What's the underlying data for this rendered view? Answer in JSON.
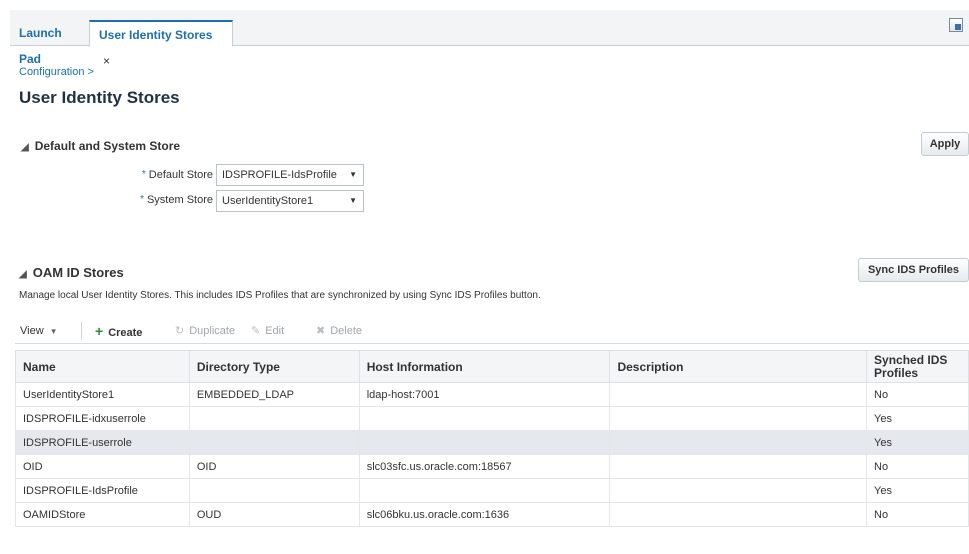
{
  "tabs": [
    {
      "label": "Launch Pad"
    },
    {
      "label": "User Identity Stores",
      "close": "×"
    }
  ],
  "breadcrumb": "Configuration >",
  "page_title": "User Identity Stores",
  "default_section": {
    "title": "Default and System Store",
    "apply_label": "Apply",
    "default_store": {
      "label": "Default Store",
      "value": "IDSPROFILE-IdsProfile"
    },
    "system_store": {
      "label": "System Store",
      "value": "UserIdentityStore1"
    }
  },
  "oam_section": {
    "title": "OAM ID Stores",
    "sync_label": "Sync IDS Profiles",
    "description": "Manage local User Identity Stores. This includes IDS Profiles that are synchronized by using Sync IDS Profiles button."
  },
  "toolbar": {
    "view": "View",
    "create": "Create",
    "duplicate": "Duplicate",
    "edit": "Edit",
    "delete": "Delete"
  },
  "table": {
    "headers": [
      "Name",
      "Directory Type",
      "Host Information",
      "Description",
      "Synched IDS Profiles"
    ],
    "rows": [
      [
        "UserIdentityStore1",
        "EMBEDDED_LDAP",
        "ldap-host:7001",
        "",
        "No"
      ],
      [
        "IDSPROFILE-idxuserrole",
        "",
        "",
        "",
        "Yes"
      ],
      [
        "IDSPROFILE-userrole",
        "",
        "",
        "",
        "Yes"
      ],
      [
        "OID",
        "OID",
        "slc03sfc.us.oracle.com:18567",
        "",
        "No"
      ],
      [
        "IDSPROFILE-IdsProfile",
        "",
        "",
        "",
        "Yes"
      ],
      [
        "OAMIDStore",
        "OUD",
        "slc06bku.us.oracle.com:1636",
        "",
        "No"
      ]
    ]
  },
  "colors": {
    "accent": "#1d6fb2",
    "selected_row": "#e5e8ec"
  }
}
